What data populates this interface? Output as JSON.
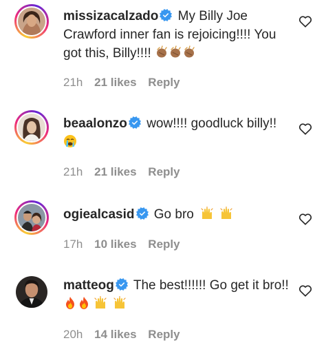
{
  "comments": [
    {
      "username": "missizacalzado",
      "verified": true,
      "text": "My Billy Joe Crawford inner fan is rejoicing!!!! You got this, Billy!!!!",
      "emoji": "clapping-hands-x3",
      "time": "21h",
      "likes": "21 likes",
      "reply": "Reply"
    },
    {
      "username": "beaalonzo",
      "verified": true,
      "text": "wow!!!! goodluck billy!!",
      "emoji": "loudly-crying-face",
      "time": "21h",
      "likes": "21 likes",
      "reply": "Reply"
    },
    {
      "username": "ogiealcasid",
      "verified": true,
      "text": "Go bro",
      "emoji": "raising-hands-x2",
      "time": "17h",
      "likes": "10 likes",
      "reply": "Reply"
    },
    {
      "username": "matteog",
      "verified": true,
      "text": "The best!!!!!! Go get it bro!!",
      "emoji": "fire-x2-raising-hands-x2",
      "time": "20h",
      "likes": "14 likes",
      "reply": "Reply"
    }
  ],
  "colors": {
    "verified_blue": "#3897f0",
    "meta_gray": "#8e8e8e",
    "text": "#262626"
  },
  "icons": {
    "like": "heart-outline-icon",
    "verified": "verified-badge-icon"
  }
}
